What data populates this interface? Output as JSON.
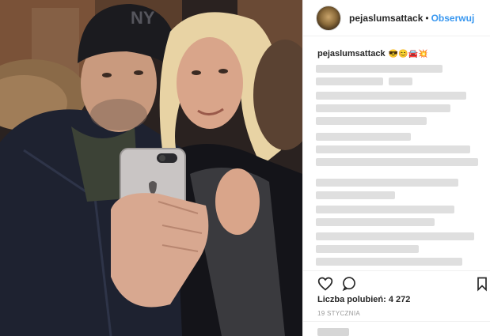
{
  "post": {
    "username": "pejaslumsattack",
    "separator": "•",
    "follow_label": "Obserwuj",
    "caption_user": "pejaslumsattack",
    "caption_emoji": "😎😊🚘💥",
    "likes_text": "Liczba polubień: 4 272",
    "date": "19 STYCZNIA"
  },
  "icons": {
    "like": "heart-icon",
    "comment": "comment-icon",
    "save": "bookmark-icon"
  },
  "colors": {
    "link": "#3897f0",
    "text": "#262626",
    "muted": "#999999"
  }
}
